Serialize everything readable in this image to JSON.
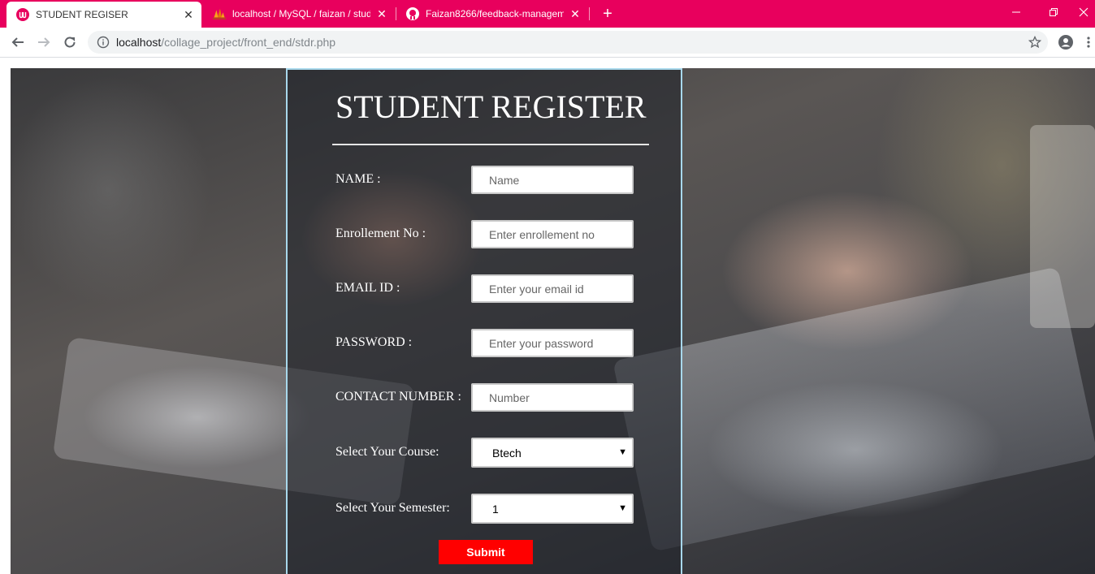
{
  "browser": {
    "tabs": [
      {
        "title": "STUDENT REGISER",
        "active": true,
        "icon": "app-logo-icon"
      },
      {
        "title": "localhost / MySQL / faizan / stud",
        "active": false,
        "icon": "phpmyadmin-icon"
      },
      {
        "title": "Faizan8266/feedback-manageme",
        "active": false,
        "icon": "github-icon"
      }
    ],
    "url_host": "localhost",
    "url_path": "/collage_project/front_end/stdr.php",
    "accent_color": "#e8005d"
  },
  "form": {
    "title": "STUDENT REGISTER",
    "fields": {
      "name": {
        "label": "NAME :",
        "placeholder": "Name",
        "value": ""
      },
      "enrollment": {
        "label": "Enrollement No :",
        "placeholder": "Enter enrollement no",
        "value": ""
      },
      "email": {
        "label": "EMAIL ID :",
        "placeholder": "Enter your email id",
        "value": ""
      },
      "password": {
        "label": "PASSWORD :",
        "placeholder": "Enter your password",
        "value": ""
      },
      "contact": {
        "label": "CONTACT NUMBER :",
        "placeholder": "Number",
        "value": ""
      },
      "course": {
        "label": "Select Your Course:",
        "selected": "Btech"
      },
      "semester": {
        "label": "Select Your Semester:",
        "selected": "1"
      }
    },
    "submit_label": "Submit",
    "submit_color": "#ff0000",
    "panel_border_color": "#a8d8ec"
  }
}
